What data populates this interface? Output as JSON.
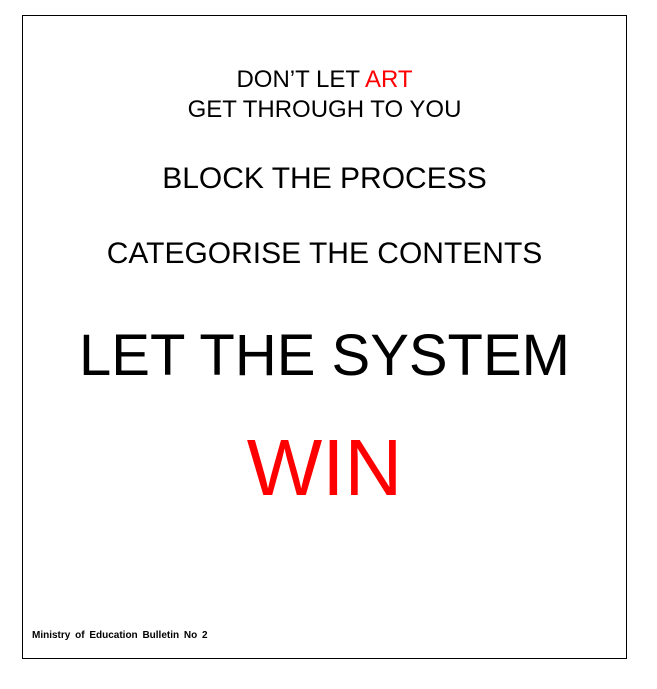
{
  "poster": {
    "line1_prefix": "DON’T LET ",
    "line1_highlight": "ART",
    "line2": "GET THROUGH TO YOU",
    "line3": "BLOCK THE PROCESS",
    "line4": "CATEGORISE THE CONTENTS",
    "line5": "LET THE SYSTEM",
    "line6": "WIN",
    "footer": "Ministry of Education Bulletin No 2",
    "accent_color": "#ff0000"
  }
}
